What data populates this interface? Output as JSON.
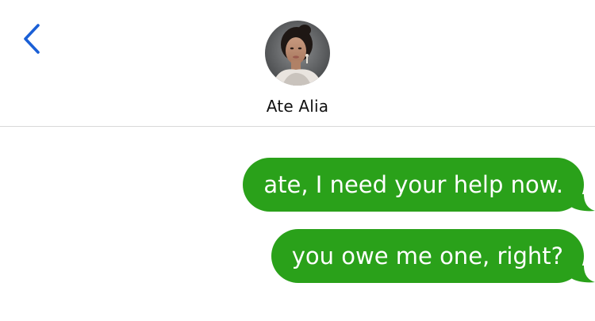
{
  "header": {
    "back_icon": "chevron-left-icon",
    "contact_name": "Ate Alia",
    "accent_color": "#1a5fd6"
  },
  "thread": {
    "bubble_color": "#2aa11a",
    "messages": [
      {
        "direction": "sent",
        "text": "ate, I need your help now."
      },
      {
        "direction": "sent",
        "text": "you owe me one, right?"
      }
    ]
  }
}
